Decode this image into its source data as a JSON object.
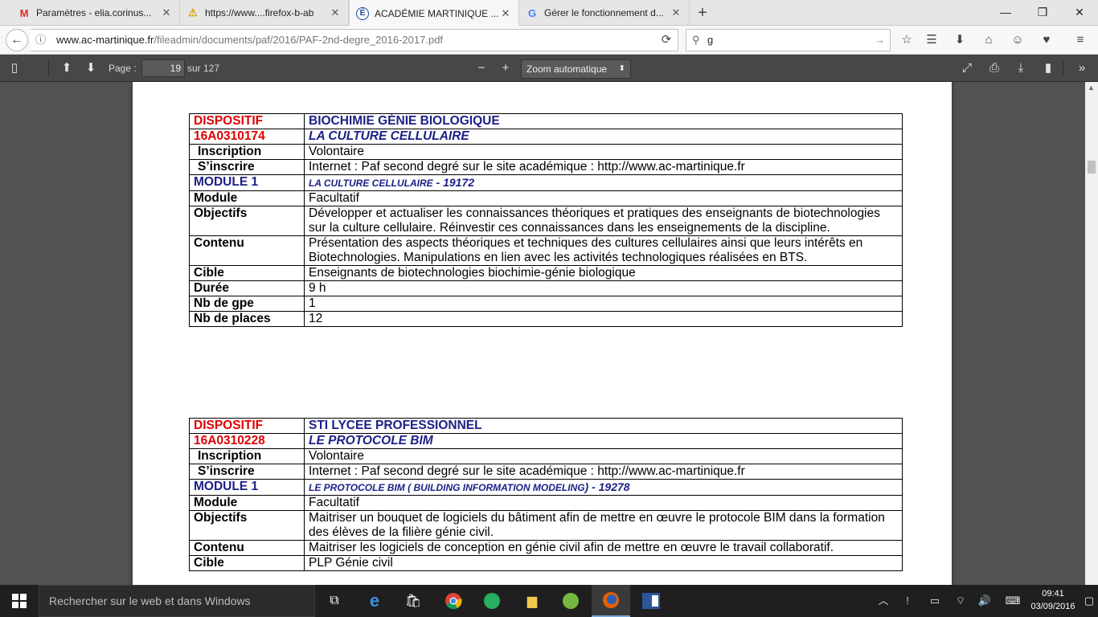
{
  "tabs": [
    {
      "title": "Paramètres - elia.corinus...",
      "icon": "gmail-icon"
    },
    {
      "title": "https://www....firefox-b-ab",
      "icon": "warning-icon"
    },
    {
      "title": "ACADÉMIE MARTINIQUE ...",
      "icon": "academie-icon",
      "active": true
    },
    {
      "title": "Gérer le fonctionnement d...",
      "icon": "google-icon"
    }
  ],
  "url": {
    "host": "www.ac-martinique.fr",
    "path": "/fileadmin/documents/paf/2016/PAF-2nd-degre_2016-2017.pdf"
  },
  "search": {
    "value": "g"
  },
  "pdf_toolbar": {
    "page_label": "Page :",
    "page_value": "19",
    "page_count": "sur 127",
    "zoom": "Zoom automatique"
  },
  "dispositifs": [
    {
      "label": "DISPOSITIF",
      "name": "BIOCHIMIE  GÉNIE BIOLOGIQUE",
      "code": "16A0310174",
      "title": "LA CULTURE CELLULAIRE",
      "rows": [
        {
          "k": "Inscription",
          "v": "Volontaire"
        },
        {
          "k": "S’inscrire",
          "v": "Internet : Paf second degré sur le site académique : http://www.ac-martinique.fr"
        }
      ],
      "module_label": "MODULE 1",
      "module_title": "LA CULTURE CELLULAIRE",
      "module_code": " - 19172",
      "rows2": [
        {
          "k": "Module",
          "v": "Facultatif"
        },
        {
          "k": "Objectifs",
          "v": "Développer et actualiser les connaissances théoriques et pratiques des enseignants de biotechnologies sur la culture cellulaire. Réinvestir ces connaissances dans les enseignements de la discipline."
        },
        {
          "k": "Contenu",
          "v": "Présentation des aspects théoriques et techniques des cultures cellulaires ainsi que leurs intérêts en Biotechnologies. Manipulations en lien avec les activités technologiques réalisées en BTS."
        },
        {
          "k": "Cible",
          "v": "Enseignants de biotechnologies biochimie-génie biologique"
        },
        {
          "k": "Durée",
          "v": "9 h"
        },
        {
          "k": "Nb de gpe",
          "v": "1"
        },
        {
          "k": "Nb de places",
          "v": "12"
        }
      ]
    },
    {
      "label": "DISPOSITIF",
      "name": "STI LYCEE PROFESSIONNEL",
      "code": "16A0310228",
      "title": "LE PROTOCOLE BIM",
      "rows": [
        {
          "k": "Inscription",
          "v": "Volontaire"
        },
        {
          "k": "S’inscrire",
          "v": "Internet : Paf second degré sur le site académique : http://www.ac-martinique.fr"
        }
      ],
      "module_label": "MODULE 1",
      "module_title": "LE PROTOCOLE  BIM  ( BUILDING INFORMATION MODELING",
      "module_code": ")  - 19278",
      "rows2": [
        {
          "k": "Module",
          "v": "Facultatif"
        },
        {
          "k": "Objectifs",
          "v": "Maitriser un bouquet de logiciels du bâtiment afin de mettre en œuvre le protocole BIM dans la formation des élèves de la filière génie civil."
        },
        {
          "k": "Contenu",
          "v": "Maitriser les logiciels de conception en génie civil afin de mettre en œuvre le travail collaboratif."
        },
        {
          "k": "Cible",
          "v": "PLP Génie civil"
        }
      ]
    }
  ],
  "taskbar": {
    "search_placeholder": "Rechercher sur le web et dans Windows",
    "time": "09:41",
    "date": "03/09/2016"
  }
}
